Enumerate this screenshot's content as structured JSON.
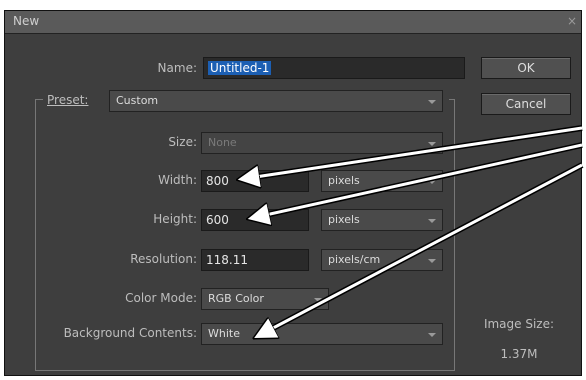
{
  "dialog": {
    "title": "New",
    "close_glyph": "×",
    "name_label": "Name:",
    "name_value": "Untitled-1",
    "preset_label": "Preset:",
    "preset_value": "Custom",
    "size_label": "Size:",
    "size_value": "None",
    "width_label": "Width:",
    "width_value": "800",
    "width_unit": "pixels",
    "height_label": "Height:",
    "height_value": "600",
    "height_unit": "pixels",
    "resolution_label": "Resolution:",
    "resolution_value": "118.11",
    "resolution_unit": "pixels/cm",
    "color_mode_label": "Color Mode:",
    "color_mode_value": "RGB Color",
    "bg_label": "Background Contents:",
    "bg_value": "White",
    "ok_label": "OK",
    "cancel_label": "Cancel",
    "image_size_label": "Image Size:",
    "image_size_value": "1.37M"
  },
  "colors": {
    "dialog_bg": "#3e3e3e",
    "highlight": "#1c5fb3",
    "annotation_arrow": "#ffffff"
  }
}
